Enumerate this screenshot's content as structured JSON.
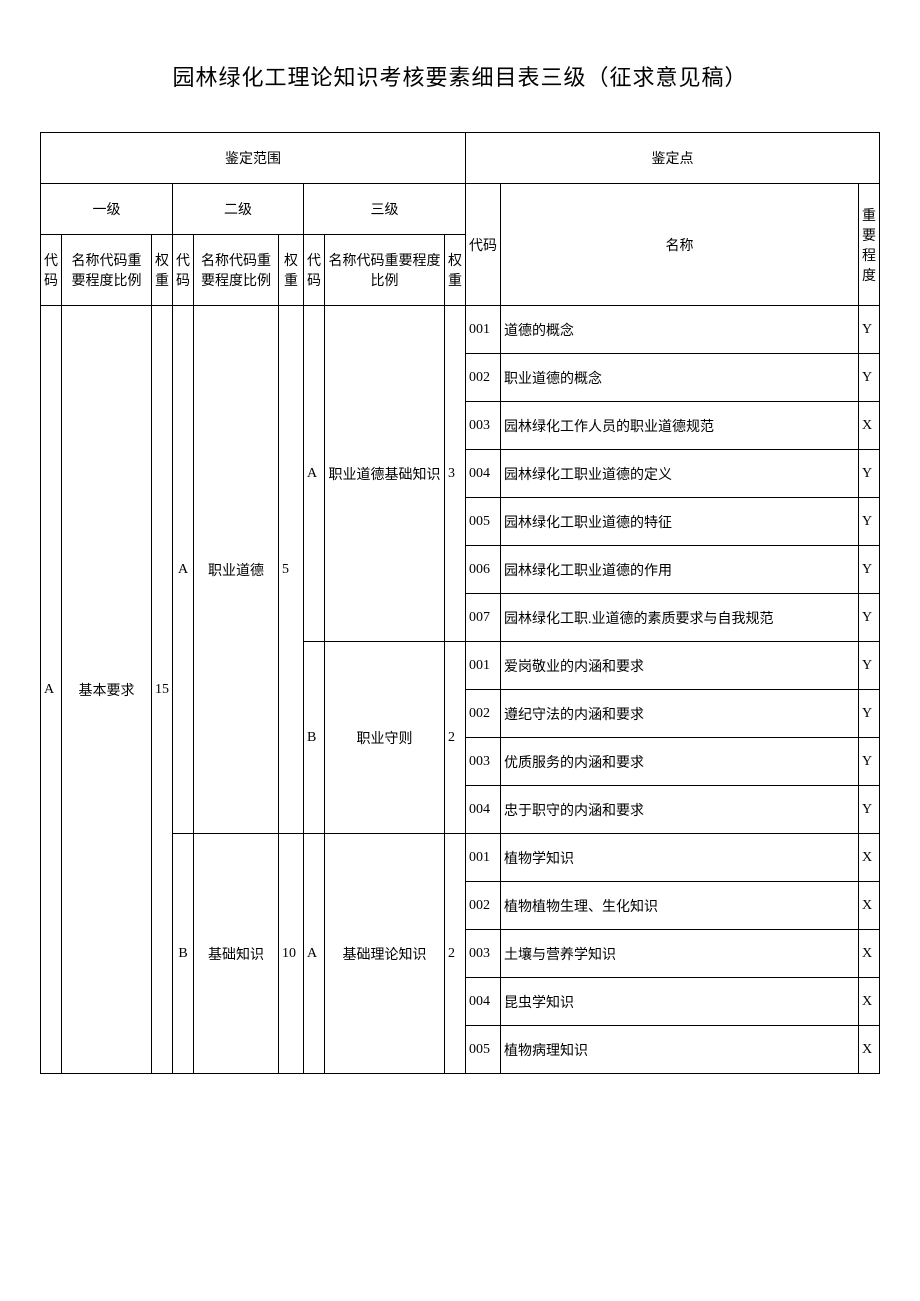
{
  "title": "园林绿化工理论知识考核要素细目表三级（征求意见稿）",
  "headers": {
    "scope": "鉴定范围",
    "point": "鉴定点",
    "level1": "一级",
    "level2": "二级",
    "level3": "三级",
    "code": "代码",
    "name": "名称",
    "importance": "重要程度",
    "name_code_importance_ratio": "名称代码重要程度比例",
    "name_code_importance_ratio_2": "名称代码重要程度比例",
    "name_code_importance_ratio_3": "名称代码重要程度比例",
    "weight": "权重"
  },
  "l1": {
    "code": "A",
    "name": "基本要求",
    "weight": "15"
  },
  "l2": [
    {
      "code": "A",
      "name": "职业道德",
      "weight": "5"
    },
    {
      "code": "B",
      "name": "基础知识",
      "weight": "10"
    }
  ],
  "l3": [
    {
      "code": "A",
      "name": "职业道德基础知识",
      "weight": "3"
    },
    {
      "code": "B",
      "name": "职业守则",
      "weight": "2"
    },
    {
      "code": "A",
      "name": "基础理论知识",
      "weight": "2"
    }
  ],
  "points": [
    {
      "code": "001",
      "name": "道德的概念",
      "level": "Y"
    },
    {
      "code": "002",
      "name": "职业道德的概念",
      "level": "Y"
    },
    {
      "code": "003",
      "name": "园林绿化工作人员的职业道德规范",
      "level": "X"
    },
    {
      "code": "004",
      "name": "园林绿化工职业道德的定义",
      "level": "Y"
    },
    {
      "code": "005",
      "name": "园林绿化工职业道德的特征",
      "level": "Y"
    },
    {
      "code": "006",
      "name": "园林绿化工职业道德的作用",
      "level": "Y"
    },
    {
      "code": "007",
      "name": "园林绿化工职.业道德的素质要求与自我规范",
      "level": "Y"
    },
    {
      "code": "001",
      "name": "爱岗敬业的内涵和要求",
      "level": "Y"
    },
    {
      "code": "002",
      "name": "遵纪守法的内涵和要求",
      "level": "Y"
    },
    {
      "code": "003",
      "name": "优质服务的内涵和要求",
      "level": "Y"
    },
    {
      "code": "004",
      "name": "忠于职守的内涵和要求",
      "level": "Y"
    },
    {
      "code": "001",
      "name": "植物学知识",
      "level": "X"
    },
    {
      "code": "002",
      "name": "植物植物生理、生化知识",
      "level": "X"
    },
    {
      "code": "003",
      "name": "土壤与营养学知识",
      "level": "X"
    },
    {
      "code": "004",
      "name": "昆虫学知识",
      "level": "X"
    },
    {
      "code": "005",
      "name": "植物病理知识",
      "level": "X"
    }
  ]
}
